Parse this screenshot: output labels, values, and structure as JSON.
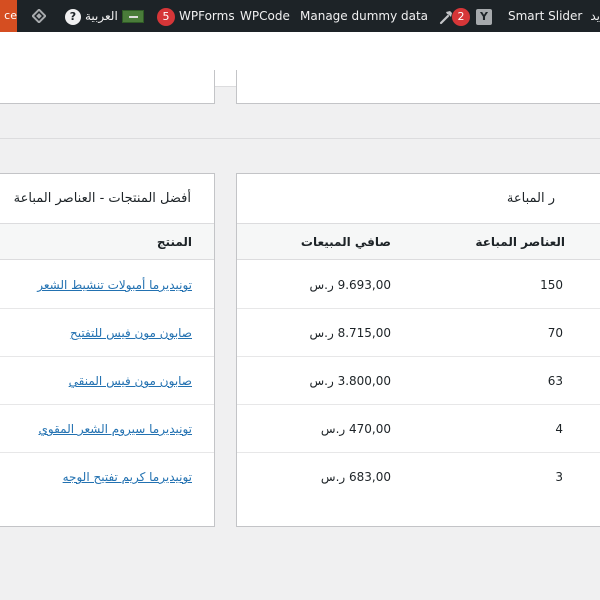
{
  "admin_bar": {
    "orange_fragment": "ce",
    "language_label": "العربية",
    "help_glyph": "?",
    "wpforms_count": "5",
    "wpforms_label": "WPForms",
    "wpcode_label": "WPCode",
    "dummy_data_label": "Manage dummy data",
    "yoast_count": "2",
    "smart_slider_label": "Smart Slider",
    "trailing_fragment": "يد"
  },
  "top_products_card": {
    "title": "أفضل المنتجات - العناصر المباعة",
    "column_product": "المنتج",
    "products": [
      "تونيديرما أمبولات تنشيط الشعر",
      "صابون مون فيس للتفتيح",
      "صابون مون فيس المنقي",
      "تونيديرما سيروم الشعر المقوي",
      "تونيديرما كريم تفتيح الوجه"
    ]
  },
  "sales_card": {
    "title": "ر المباعة",
    "column_items_sold": "العناصر المباعة",
    "column_net_sales": "صافي المبيعات",
    "rows": [
      {
        "items_sold": "150",
        "net_sales": "9.693,00 ر.س"
      },
      {
        "items_sold": "70",
        "net_sales": "8.715,00 ر.س"
      },
      {
        "items_sold": "63",
        "net_sales": "3.800,00 ر.س"
      },
      {
        "items_sold": "4",
        "net_sales": "470,00 ر.س"
      },
      {
        "items_sold": "3",
        "net_sales": "683,00 ر.س"
      }
    ]
  },
  "colors": {
    "admin_bar_bg": "#1d2327",
    "accent_orange": "#d54e21",
    "badge_red": "#d63638",
    "link_blue": "#2271b1"
  },
  "icons": [
    "wordpress-diamond-icon",
    "help-icon",
    "flag-icon",
    "hammer-icon",
    "yoast-icon"
  ]
}
